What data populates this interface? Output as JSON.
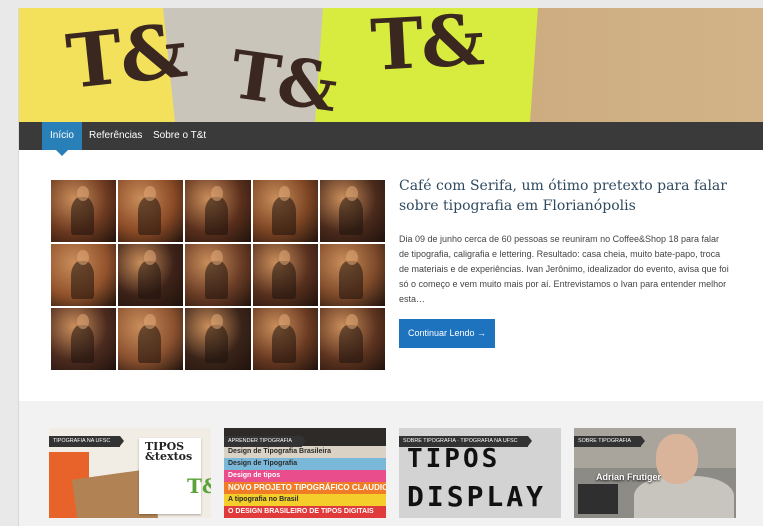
{
  "banner": {
    "logo_text": "T&"
  },
  "nav": [
    {
      "label": "Início",
      "active": true
    },
    {
      "label": "Referências",
      "active": false
    },
    {
      "label": "Sobre o T&t",
      "active": false
    }
  ],
  "featured": {
    "title": "Café com Serifa, um ótimo pretexto para falar sobre tipografia em Florianópolis",
    "excerpt": "Dia 09 de junho cerca de 60 pessoas se reuniram no Coffee&Shop 18 para falar de tipografia, caligrafia e lettering. Resultado: casa cheia, muito bate-papo, troca de materiais e de experiências. Ivan Jerônimo, idealizador do evento, avisa que foi só o começo e vem muito mais por aí. Entrevistamos o Ivan para entender melhor esta…",
    "read_more": "Continuar Lendo →",
    "collage_tiles": 15
  },
  "thumbs": [
    {
      "category": "TIPOGRAFIA NA UFSC",
      "art_text": [
        "TIPOS",
        "&textos"
      ],
      "art_small": "T&"
    },
    {
      "category": "APRENDER TIPOGRAFIA",
      "art_bands": [
        "Design de Tipografia Brasileira",
        "Design de Tipografia",
        "Design de tipos",
        "NOVO PROJETO TIPOGRÁFICO  CLAUDIO R",
        "A tipografia no Brasil",
        "O DESIGN BRASILEIRO DE TIPOS DIGITAIS"
      ]
    },
    {
      "category": "SOBRE TIPOGRAFIA · TIPOGRAFIA NA UFSC",
      "art_lines": [
        "TIPOS",
        "DISPLAY"
      ]
    },
    {
      "category": "SOBRE TIPOGRAFIA",
      "caption": "Adrian Frutiger"
    }
  ],
  "colors": {
    "nav_bg": "#3a3a3a",
    "nav_active": "#2980b9",
    "button": "#1e73be",
    "title": "#2f4a5f"
  }
}
